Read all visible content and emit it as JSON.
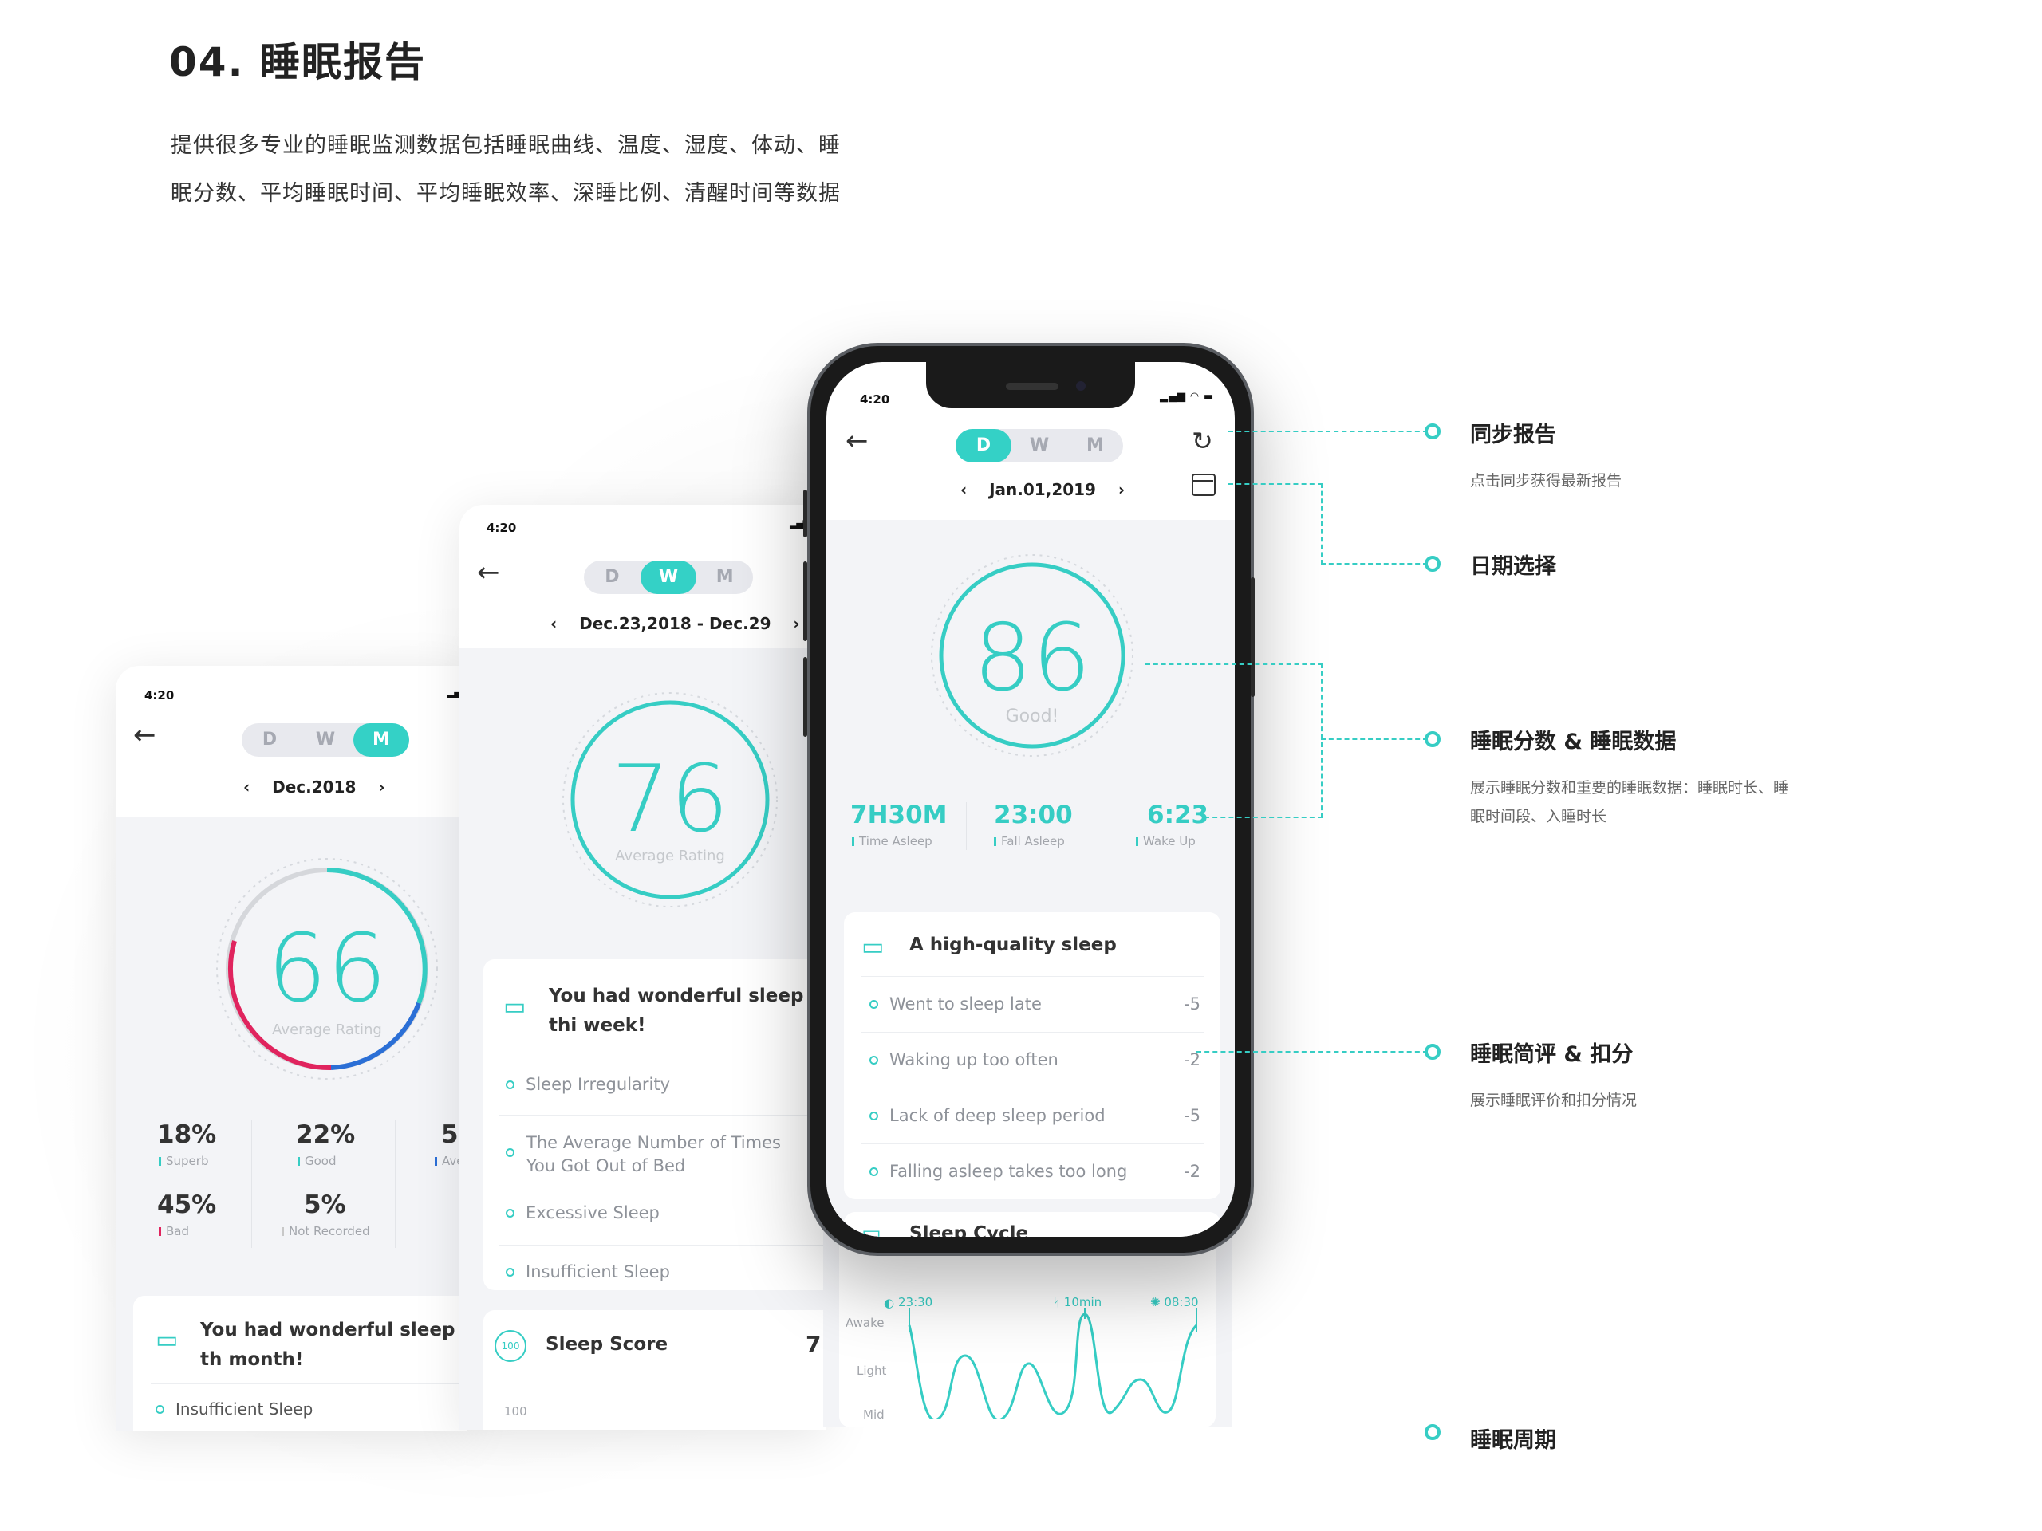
{
  "header": {
    "title": "04. 睡眠报告",
    "desc_line1": "提供很多专业的睡眠监测数据包括睡眠曲线、温度、湿度、体动、睡",
    "desc_line2": "眠分数、平均睡眠时间、平均睡眠效率、深睡比例、清醒时间等数据"
  },
  "tabs": [
    "D",
    "W",
    "M"
  ],
  "month_screen": {
    "time": "4:20",
    "active_tab": "M",
    "date": "Dec.2018",
    "score": "66",
    "score_label": "Average Rating",
    "stats": [
      {
        "value": "18%",
        "label": "Superb",
        "color": "#36cdc4"
      },
      {
        "value": "22%",
        "label": "Good",
        "color": "#36cdc4"
      },
      {
        "value": "5'",
        "label": "Ave",
        "color": "#2b6fd6"
      },
      {
        "value": "45%",
        "label": "Bad",
        "color": "#e0245e"
      },
      {
        "value": "5%",
        "label": "Not Recorded",
        "color": "#c8c8c8"
      }
    ],
    "summary_title": "You had wonderful sleep th month!",
    "items": [
      "Insufficient Sleep"
    ]
  },
  "week_screen": {
    "time": "4:20",
    "active_tab": "W",
    "date": "Dec.23,2018 - Dec.29",
    "score": "76",
    "score_label": "Average Rating",
    "summary_title": "You had wonderful sleep thi week!",
    "items": [
      "Sleep Irregularity",
      "The Average Number of Times You Got Out of Bed",
      "Excessive Sleep",
      "Insufficient Sleep"
    ],
    "score_section": "Sleep Score",
    "score_section_value": "7",
    "score_badge": "100",
    "axis_top": "100"
  },
  "day_screen": {
    "time": "4:20",
    "active_tab": "D",
    "date": "Jan.01,2019",
    "score": "86",
    "score_label": "Good!",
    "stats": [
      {
        "value": "7H30M",
        "label": "Time Asleep"
      },
      {
        "value": "23:00",
        "label": "Fall Asleep"
      },
      {
        "value": "6:23",
        "label": "Wake Up"
      }
    ],
    "summary_title": "A high-quality sleep",
    "deductions": [
      {
        "label": "Went to sleep late",
        "value": "-5"
      },
      {
        "label": "Waking up too often",
        "value": "-2"
      },
      {
        "label": "Lack of deep sleep period",
        "value": "-5"
      },
      {
        "label": "Falling asleep takes too long",
        "value": "-2"
      }
    ],
    "cycle_title": "Sleep Cycle",
    "cycle_markers": [
      "23:30",
      "10min",
      "08:30"
    ],
    "cycle_levels": [
      "Awake",
      "Light",
      "Mid"
    ]
  },
  "annotations": [
    {
      "title": "同步报告",
      "desc": "点击同步获得最新报告"
    },
    {
      "title": "日期选择",
      "desc": ""
    },
    {
      "title": "睡眠分数 & 睡眠数据",
      "desc1": "展示睡眠分数和重要的睡眠数据：睡眠时长、睡",
      "desc2": "眠时间段、入睡时长"
    },
    {
      "title": "睡眠简评 & 扣分",
      "desc": "展示睡眠评价和扣分情况"
    },
    {
      "title": "睡眠周期",
      "desc": ""
    }
  ],
  "colors": {
    "accent": "#36cdc4",
    "bad": "#e0245e",
    "blue": "#2b6fd6"
  }
}
